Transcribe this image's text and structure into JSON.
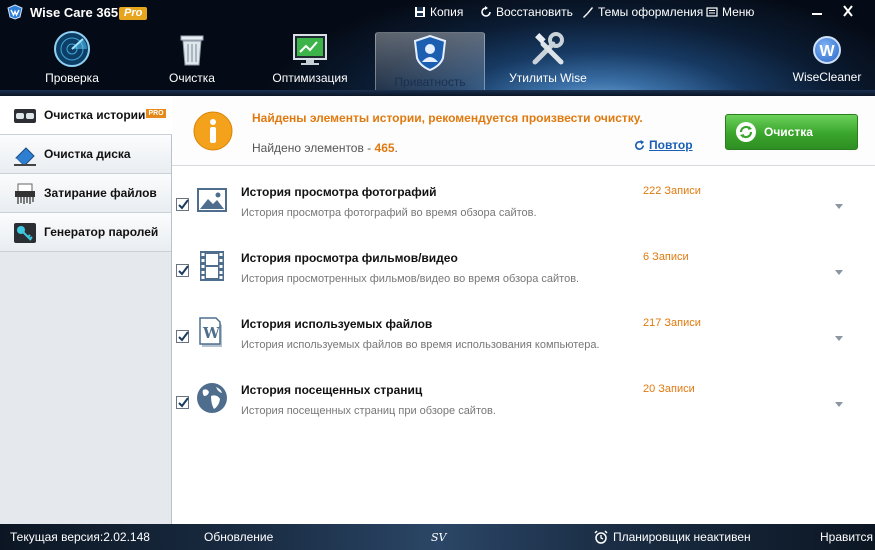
{
  "app": {
    "title": "Wise Care 365",
    "badge": "Pro"
  },
  "titlebar": {
    "links": [
      {
        "label": "Копия",
        "icon": "save-icon"
      },
      {
        "label": "Восстановить",
        "icon": "restore-icon"
      },
      {
        "label": "Темы оформления",
        "icon": "themes-icon"
      },
      {
        "label": "Меню",
        "icon": "menu-icon"
      }
    ]
  },
  "nav": {
    "items": [
      {
        "label": "Проверка",
        "icon": "radar-icon"
      },
      {
        "label": "Очистка",
        "icon": "trash-icon"
      },
      {
        "label": "Оптимизация",
        "icon": "monitor-icon"
      },
      {
        "label": "Приватность",
        "icon": "shield-icon",
        "active": true
      },
      {
        "label": "Утилиты Wise",
        "icon": "tools-icon"
      }
    ],
    "brand": {
      "label": "WiseCleaner",
      "letter": "W"
    }
  },
  "sidebar": {
    "items": [
      {
        "label": "Очистка истории",
        "badge": "PRO",
        "icon": "glasses-icon",
        "active": true
      },
      {
        "label": "Очистка диска",
        "icon": "eraser-icon"
      },
      {
        "label": "Затирание файлов",
        "icon": "shredder-icon"
      },
      {
        "label": "Генератор паролей",
        "icon": "key-icon"
      }
    ]
  },
  "notice": {
    "message": "Найдены элементы истории, рекомендуется произвести очистку.",
    "found_label": "Найдено элементов - ",
    "found_count": "465",
    "found_suffix": ".",
    "retry_label": "Повтор",
    "clean_button": "Очистка"
  },
  "rows": [
    {
      "title": "История просмотра фотографий",
      "desc": "История просмотра фотографий во время обзора сайтов.",
      "count": "222 Записи",
      "icon": "picture-icon",
      "checked": true
    },
    {
      "title": "История просмотра фильмов/видео",
      "desc": "История просмотренных фильмов/видео во время обзора сайтов.",
      "count": "6 Записи",
      "icon": "film-icon",
      "checked": true
    },
    {
      "title": "История используемых файлов",
      "desc": "История используемых файлов во время использования компьютера.",
      "count": "217 Записи",
      "icon": "document-icon",
      "checked": true
    },
    {
      "title": "История посещенных страниц",
      "desc": "История посещенных страниц при обзоре сайтов.",
      "count": "20 Записи",
      "icon": "globe-icon",
      "checked": true
    }
  ],
  "status": {
    "version": "Текущая версия:2.02.148",
    "update": "Обновление",
    "sv": "SV",
    "scheduler": "Планировщик неактивен",
    "like": "Нравится"
  },
  "colors": {
    "accent_orange": "#e07a10",
    "link_blue": "#1a5fb5",
    "clean_green": "#3aa52c",
    "pro_badge": "#e7a51d"
  }
}
